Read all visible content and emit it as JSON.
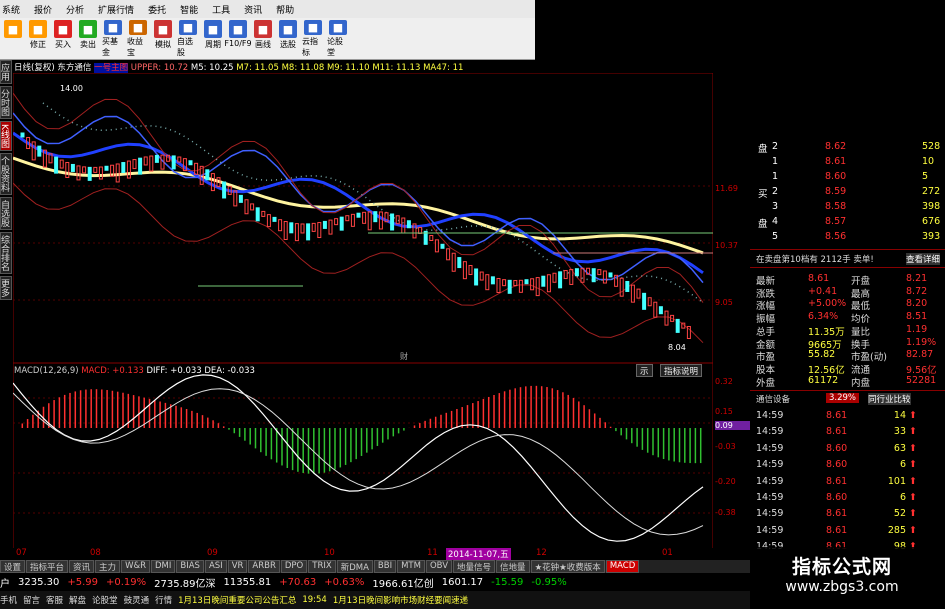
{
  "menubar": [
    "系统",
    "报价",
    "分析",
    "扩展行情",
    "委托",
    "智能",
    "工具",
    "资讯",
    "帮助"
  ],
  "toolbar": [
    {
      "label": "",
      "color": "#f90"
    },
    {
      "label": "修正",
      "color": "#f90"
    },
    {
      "label": "买入",
      "color": "#d22"
    },
    {
      "label": "卖出",
      "color": "#2a2"
    },
    {
      "label": "买基金",
      "color": "#36c"
    },
    {
      "label": "收益宝",
      "color": "#c60"
    },
    {
      "label": "模拟",
      "color": "#c33"
    },
    {
      "label": "自选股",
      "color": "#36c"
    },
    {
      "label": "周期",
      "color": "#36c"
    },
    {
      "label": "F10/F9",
      "color": "#36c"
    },
    {
      "label": "画线",
      "color": "#c33"
    },
    {
      "label": "选股",
      "color": "#36c"
    },
    {
      "label": "云指标",
      "color": "#36c"
    },
    {
      "label": "论股堂",
      "color": "#36c"
    }
  ],
  "leftnav": [
    "应用",
    "分时图",
    "K线图",
    "个股资料",
    "自选股",
    "综合排名",
    "更多"
  ],
  "info": {
    "period": "日线(复权)",
    "name": "东方通信",
    "main": "一号主图",
    "upper": "UPPER: 10.72",
    "m5": "M5: 10.25",
    "m7": "M7: 11.05",
    "m8": "M8: 11.08",
    "m9": "M9: 11.10",
    "m11": "M11: 11.13",
    "ma47": "MA47: 11"
  },
  "price_labels": {
    "high": "14.00",
    "low": "8.04",
    "axis": [
      "11.69",
      "10.37",
      "9.05"
    ],
    "cai": "财"
  },
  "macd": {
    "title": "MACD(12,26,9)",
    "macd": "MACD: +0.133",
    "diff": "DIFF: +0.033",
    "dea": "DEA: -0.033",
    "axis": [
      "0.32",
      "0.15",
      "0.09",
      "-0.03",
      "-0.20",
      "-0.38"
    ]
  },
  "buttons": {
    "b1": "示",
    "b2": "指标说明"
  },
  "xaxis": [
    "07",
    "08",
    "09",
    "10",
    "11",
    "2014-11-07,五",
    "12",
    "01"
  ],
  "tabs": [
    "设置",
    "指标平台",
    "资讯",
    "主力",
    "W&R",
    "DMI",
    "BIAS",
    "ASI",
    "VR",
    "ARBR",
    "DPO",
    "TRIX",
    "新DMA",
    "BBI",
    "MTM",
    "OBV",
    "地量信号",
    "信地量",
    "★花钟★收费版本",
    "MACD"
  ],
  "index": [
    {
      "label": "户",
      "val": "3235.30"
    },
    {
      "label": "",
      "val": "+5.99"
    },
    {
      "label": "",
      "val": "+0.19%"
    },
    {
      "label": "",
      "val": "2735.89亿深"
    },
    {
      "label": "",
      "val": "11355.81"
    },
    {
      "label": "",
      "val": "+70.63"
    },
    {
      "label": "",
      "val": "+0.63%"
    },
    {
      "label": "",
      "val": "1966.61亿创"
    },
    {
      "label": "",
      "val": "1601.17"
    },
    {
      "label": "",
      "val": "-15.59"
    },
    {
      "label": "",
      "val": "-0.95%"
    }
  ],
  "ticker": [
    "手机",
    "留言",
    "客服",
    "解盘",
    "论股堂",
    "鼓灵通",
    "行情",
    "1月13日晚间重要公司公告汇总",
    "19:54",
    "1月13日晚间影响市场财经要闻速递"
  ],
  "orderbook": {
    "sell": [
      {
        "side": "盘",
        "lvl": "2",
        "p": "8.62",
        "v": "528"
      },
      {
        "side": "",
        "lvl": "1",
        "p": "8.61",
        "v": "10"
      },
      {
        "side": "",
        "lvl": "1",
        "p": "8.60",
        "v": "5"
      },
      {
        "side": "买",
        "lvl": "2",
        "p": "8.59",
        "v": "272"
      },
      {
        "side": "",
        "lvl": "3",
        "p": "8.58",
        "v": "398"
      },
      {
        "side": "盘",
        "lvl": "4",
        "p": "8.57",
        "v": "676"
      },
      {
        "side": "",
        "lvl": "5",
        "p": "8.56",
        "v": "393"
      }
    ],
    "inline": "在卖盘第10档有 2112手  卖单!",
    "detail": "查看详细"
  },
  "stats": [
    {
      "k": "最新",
      "v": "8.61",
      "k2": "开盘",
      "v2": "8.21"
    },
    {
      "k": "涨跌",
      "v": "+0.41",
      "k2": "最高",
      "v2": "8.72"
    },
    {
      "k": "涨幅",
      "v": "+5.00%",
      "k2": "最低",
      "v2": "8.20"
    },
    {
      "k": "振幅",
      "v": "6.34%",
      "k2": "均价",
      "v2": "8.51"
    },
    {
      "k": "总手",
      "v": "11.35万",
      "k2": "量比",
      "v2": "1.19"
    },
    {
      "k": "金额",
      "v": "9665万",
      "k2": "换手",
      "v2": "1.19%"
    },
    {
      "k": "市盈",
      "v": "55.82",
      "k2": "市盈(动)",
      "v2": "82.87"
    },
    {
      "k": "股本",
      "v": "12.56亿",
      "k2": "流通",
      "v2": "9.56亿"
    },
    {
      "k": "外盘",
      "v": "61172",
      "k2": "内盘",
      "v2": "52281"
    }
  ],
  "industry": {
    "name": "通信设备",
    "pct": "3.29%",
    "btn": "同行业比较"
  },
  "trades": [
    {
      "t": "14:59",
      "p": "8.61",
      "v": "14"
    },
    {
      "t": "14:59",
      "p": "8.61",
      "v": "33"
    },
    {
      "t": "14:59",
      "p": "8.60",
      "v": "63"
    },
    {
      "t": "14:59",
      "p": "8.60",
      "v": "6"
    },
    {
      "t": "14:59",
      "p": "8.61",
      "v": "101"
    },
    {
      "t": "14:59",
      "p": "8.60",
      "v": "6"
    },
    {
      "t": "14:59",
      "p": "8.61",
      "v": "52"
    },
    {
      "t": "14:59",
      "p": "8.61",
      "v": "285"
    },
    {
      "t": "14:59",
      "p": "8.61",
      "v": "98"
    }
  ],
  "watermark": {
    "t1": "指标公式网",
    "t2": "www.zbgs3.com"
  }
}
